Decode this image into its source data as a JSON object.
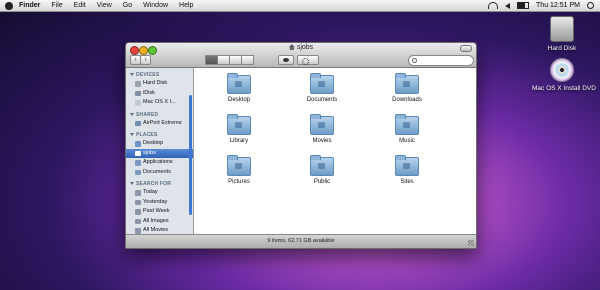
{
  "menubar": {
    "app": "Finder",
    "items": [
      "File",
      "Edit",
      "View",
      "Go",
      "Window",
      "Help"
    ],
    "clock": "Thu 12:51 PM"
  },
  "desktop": {
    "icons": [
      {
        "label": "Hard Disk",
        "icon": "hard-disk-icon"
      },
      {
        "label": "Mac OS X Install DVD",
        "icon": "dvd-icon"
      }
    ]
  },
  "window": {
    "title": "sjobs",
    "sidebar": {
      "sections": [
        {
          "title": "DEVICES",
          "items": [
            {
              "label": "Hard Disk",
              "icon": "hard-disk-icon",
              "color": "#9aa4ae"
            },
            {
              "label": "iDisk",
              "icon": "idisk-icon",
              "color": "#7e8ea0"
            },
            {
              "label": "Mac OS X I...",
              "icon": "dvd-icon",
              "color": "#c0c8d4"
            }
          ]
        },
        {
          "title": "SHARED",
          "items": [
            {
              "label": "AirPort Extreme",
              "icon": "network-icon",
              "color": "#6f8fb0"
            }
          ]
        },
        {
          "title": "PLACES",
          "items": [
            {
              "label": "Desktop",
              "icon": "desktop-icon",
              "color": "#6d94c4"
            },
            {
              "label": "sjobs",
              "icon": "home-icon",
              "color": "#ffffff",
              "selected": true
            },
            {
              "label": "Applications",
              "icon": "applications-icon",
              "color": "#7d99c0"
            },
            {
              "label": "Documents",
              "icon": "documents-icon",
              "color": "#7d99c0"
            }
          ]
        },
        {
          "title": "SEARCH FOR",
          "items": [
            {
              "label": "Today",
              "icon": "clock-icon",
              "color": "#8b97a8"
            },
            {
              "label": "Yesterday",
              "icon": "clock-icon",
              "color": "#8b97a8"
            },
            {
              "label": "Past Week",
              "icon": "clock-icon",
              "color": "#8b97a8"
            },
            {
              "label": "All Images",
              "icon": "smart-folder-icon",
              "color": "#8b97a8"
            },
            {
              "label": "All Movies",
              "icon": "smart-folder-icon",
              "color": "#8b97a8"
            }
          ]
        }
      ]
    },
    "folders": [
      {
        "label": "Desktop",
        "icon": "folder-desktop-icon"
      },
      {
        "label": "Documents",
        "icon": "folder-documents-icon"
      },
      {
        "label": "Downloads",
        "icon": "folder-downloads-icon"
      },
      {
        "label": "Library",
        "icon": "folder-library-icon"
      },
      {
        "label": "Movies",
        "icon": "folder-movies-icon"
      },
      {
        "label": "Music",
        "icon": "folder-music-icon"
      },
      {
        "label": "Pictures",
        "icon": "folder-pictures-icon"
      },
      {
        "label": "Public",
        "icon": "folder-public-icon"
      },
      {
        "label": "Sites",
        "icon": "folder-sites-icon"
      }
    ],
    "status": "9 items, 62.71 GB available"
  }
}
